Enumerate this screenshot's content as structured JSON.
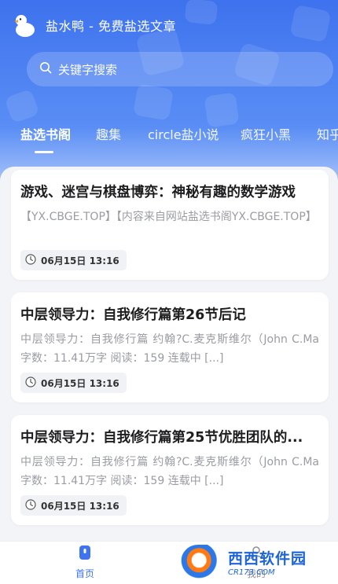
{
  "app": {
    "title": "盐水鸭 - 免费盐选文章"
  },
  "search": {
    "placeholder": "关键字搜索"
  },
  "tabs": [
    {
      "label": "盐选书阁",
      "active": true
    },
    {
      "label": "趣集",
      "active": false
    },
    {
      "label": "circle盐小说",
      "active": false
    },
    {
      "label": "疯狂小黑",
      "active": false
    },
    {
      "label": "知乎",
      "active": false
    }
  ],
  "articles": [
    {
      "title": "游戏、迷宫与棋盘博弈：神秘有趣的数学游戏",
      "summary": "【YX.CBGE.TOP】【内容来自网站盐选书阁YX.CBGE.TOP】",
      "time": "06月15日 13:16"
    },
    {
      "title": "中层领导力：自我修行篇第26节后记",
      "summary": "中层领导力：自我修行篇 约翰?C.麦克斯维尔（John C.Ma 字数：11.41万字 阅读：159 连载中 [...]",
      "time": "06月15日 13:16"
    },
    {
      "title": "中层领导力：自我修行篇第25节优胜团队的...",
      "summary": "中层领导力：自我修行篇 约翰?C.麦克斯维尔（John C.Ma 字数：11.41万字 阅读：159 连载中 [...]",
      "time": "06月15日 13:16"
    }
  ],
  "bottom_nav": [
    {
      "label": "首页",
      "active": true
    },
    {
      "label": "我的",
      "active": false
    }
  ],
  "watermark": {
    "name": "西西软件园",
    "url": "CR173.COM"
  },
  "colors": {
    "primary": "#3f74ee",
    "header_gradient_top": "#3e72ee",
    "page_background": "#f3f4f8",
    "title_text": "#1d1d1f",
    "summary_text": "#9a9ca3",
    "watermark": "#1c64d8"
  },
  "icons": {
    "logo": "duck-logo-icon",
    "search": "search-icon",
    "time": "clock-icon",
    "home": "home-icon",
    "profile": "profile-icon"
  }
}
